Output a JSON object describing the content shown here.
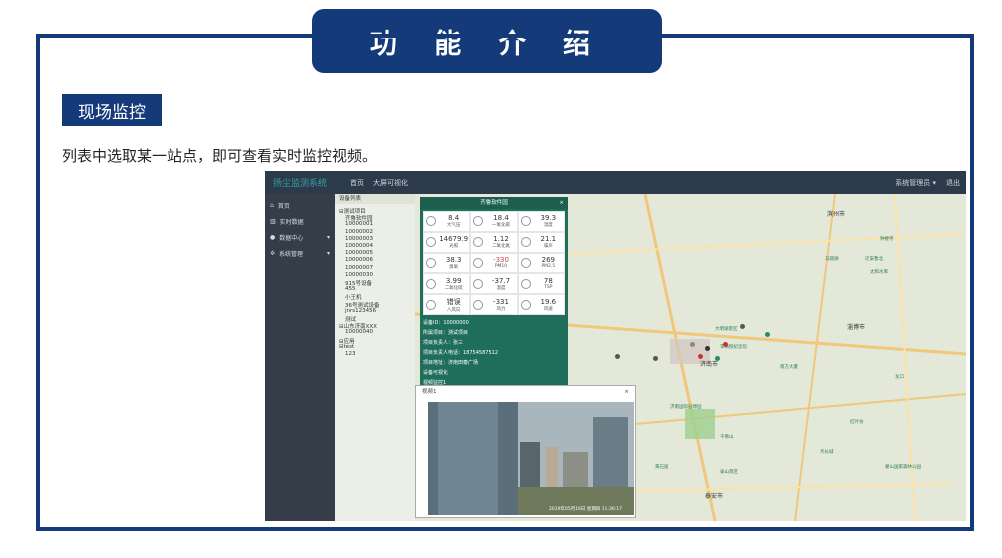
{
  "banner_title": "功 能 介 绍",
  "section_title": "现场监控",
  "description": "列表中选取某一站点，即可查看实时监控视频。",
  "app": {
    "brand": "扬尘监测系统",
    "top_nav": [
      "首页",
      "大屏可视化"
    ],
    "account": "系统管理员 ▾",
    "logout": "退出",
    "side_nav": [
      {
        "label": "首页",
        "icon": "home-icon"
      },
      {
        "label": "实时数据",
        "icon": "chart-icon"
      },
      {
        "label": "数据中心",
        "icon": "globe-icon",
        "caret": "▾"
      },
      {
        "label": "系统管理",
        "icon": "gears-icon",
        "caret": "▾"
      }
    ],
    "tree_header": "设备列表",
    "tree_items": [
      "⊟测试项目",
      "齐鲁软件园",
      "10000001",
      "10000002",
      "10000003",
      "10000004",
      "10000005",
      "10000006",
      "10000007",
      "10000030",
      "915号设备",
      "455",
      "小王机",
      "36号测试设备",
      "jnrs123456",
      "测试",
      "⊟山东济南XXX",
      "10000040",
      "⊟应用",
      "⊟test",
      "123"
    ],
    "panel": {
      "title": "齐鲁软件园",
      "close": "×",
      "cells": [
        {
          "value": "8.4",
          "unit": "大气压",
          "red": false
        },
        {
          "value": "18.4",
          "unit": "一氧化碳",
          "red": false
        },
        {
          "value": "39.3",
          "unit": "湿度",
          "red": false
        },
        {
          "value": "14679.9",
          "unit": "光照",
          "red": false
        },
        {
          "value": "1.12",
          "unit": "二氧化氮",
          "red": false
        },
        {
          "value": "21.1",
          "unit": "噪声",
          "red": false
        },
        {
          "value": "38.3",
          "unit": "臭氧",
          "red": false
        },
        {
          "value": "-330",
          "unit": "PM10",
          "red": true
        },
        {
          "value": "269",
          "unit": "PM2.5",
          "red": false
        },
        {
          "value": "3.99",
          "unit": "二氧化硫",
          "red": false
        },
        {
          "value": "-37.7",
          "unit": "温度",
          "red": false
        },
        {
          "value": "78",
          "unit": "TSP",
          "red": false
        },
        {
          "value": "错误",
          "unit": "八风向",
          "red": false
        },
        {
          "value": "-331",
          "unit": "风力",
          "red": false
        },
        {
          "value": "19.6",
          "unit": "风速",
          "red": false
        }
      ],
      "info_lines": [
        "设备ID：10000000",
        "所属项目：测试项目",
        "项目负责人：张三",
        "项目负责人电话：18754587512",
        "项目地址：济南田泰广场",
        "设备可视化",
        "视频监控1"
      ]
    },
    "video": {
      "title": "视频1",
      "close": "×",
      "timestamp": "2019年05月16日 星期四 11:36:17"
    },
    "map_labels": {
      "cities": [
        "滨州市",
        "淄博市",
        "济南市",
        "泰安市"
      ],
      "pois": [
        "迁安鲁北",
        "钟楼寺",
        "马踏湖",
        "太和水库",
        "南方大厦",
        "龙口",
        "济南国际园博园",
        "李清照纪念馆",
        "大明湖景区",
        "千佛山",
        "红叶谷",
        "齐长城",
        "蒙山国家森林公园",
        "泰山景区",
        "黄石崖"
      ]
    }
  }
}
